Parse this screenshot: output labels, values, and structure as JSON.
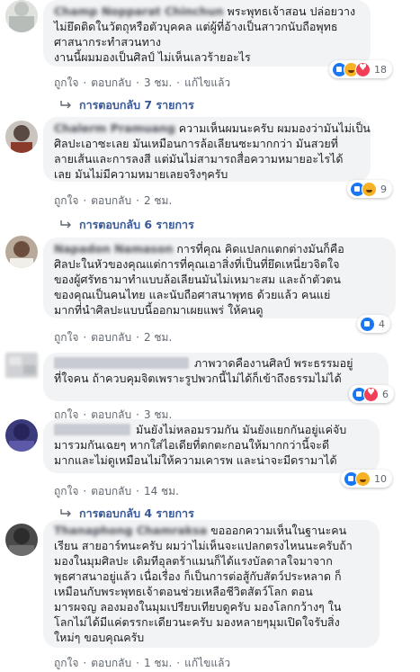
{
  "actions": {
    "like": "ถูกใจ",
    "reply": "ตอบกลับ",
    "edited": "แก้ไขแล้ว"
  },
  "comments": [
    {
      "author": "Champ Nopparat Chinchun",
      "lines": [
        "พระพุทธเจ้าสอน ปล่อยวาง",
        "ไม่ยึดติดในวัตถุหรือตัวบุคคล แต่ผู้ที่อ้างเป็นสาวกนับถือพุทธ",
        "ศาสนากระทำสวนทาง",
        "งานนี้ผมมองเป็นศิลป์ ไม่เห็นเลวร้ายอะไร"
      ],
      "time": "3 ชม.",
      "reaction_count": "18",
      "replies": "การตอบกลับ 7 รายการ"
    },
    {
      "author": "Chalerm Pramuang",
      "lines": [
        "ความเห็นผมนะครับ ผมมองว่ามันไม่เป็น",
        "ศิลปะเอาซะเลย มันเหมือนการล้อเลียนซะมากกว่า มันสวยที่",
        "ลายเส้นและการลงสี แต่มันไม่สามารถสื่อความหมายอะไรได้",
        "เลย มันไม่มีความหมายเลยจริงๆครับ"
      ],
      "time": "2 ชม.",
      "reaction_count": "9",
      "replies": "การตอบกลับ 6 รายการ"
    },
    {
      "author": "Napadon Namason",
      "lines": [
        "การที่คุณ คิดแปลกแตกต่างมันก็คือ",
        "ศิลปะในหัวของคุณแต่การที่คุณเอาสิ่งที่เป็นที่ยึดเหนี่ยวจิตใจ",
        "ของผู้ศรัทธามาทำแบบล้อเลียนมันไม่เหมาะสม และถ้าตัวตน",
        "ของคุณเป็นคนไทย และนับถือศาสนาพุทธ ด้วยแล้ว คนแย่",
        "มากที่นำศิลปะแบบนี้ออกมาเผยแพร่ ให้คนดู"
      ],
      "time": "2 ชม.",
      "reaction_count": "4"
    },
    {
      "author": "",
      "lines": [
        "ภาพวาดคืองานศิลป์ พระธรรมอยู่",
        "ที่ใจคน ถ้าควบคุมจิตเพราะรูปพวกนี้ไม่ได้ก็เข้าถึงธรรมไม่ได้"
      ],
      "time": "3 ชม.",
      "reaction_count": "6"
    },
    {
      "author": "",
      "lines": [
        "มันยังไม่หลอมรวมกัน มันยังแยกกันอยู่แค่จับ",
        "มารวมกันเฉยๆ หากใส่ไอเดียที่ตกตะกอนให้มากกว่านี้จะดี",
        "มากและไม่ดูเหมือนไม่ให้ความเคารพ และน่าจะมีดรามาได้"
      ],
      "time": "14 ชม.",
      "reaction_count": "10",
      "replies": "การตอบกลับ 4 รายการ"
    },
    {
      "author": "Thanaphong Chamraksa",
      "lines": [
        "ขอออกความเห็นในฐานะคน",
        "เรียน สายอาร์ทนะครับ ผมว่าไม่เห็นจะแปลกตรงไหนนะครับถ้า",
        "มองในมุมศิลปะ เดิมทีอุลตร้าแมนก็ได้แรงบัลดาลใจมาจาก",
        "พุธศาสนาอยู่แล้ว เนื่อเรื่อง ก็เป็นการต่อสู้กับสัตว์ประหลาด ก็",
        "เหมือนกับพระพุทธเจ้าตอนช่วยเหลือชีวิตสัตว์โลก ตอน",
        "มารผจญ ลองมองในมุมเปรียบเทียบดูครับ มองโลกกว้างๆ ใน",
        "โลกไม่ได้มีแค่ตรรกะเดียวนะครับ มองหลายๆมุมเปิดใจรับสิ่ง",
        "ใหม่ๆ ขอบคุณครับ"
      ],
      "time": "1 ชม."
    }
  ]
}
